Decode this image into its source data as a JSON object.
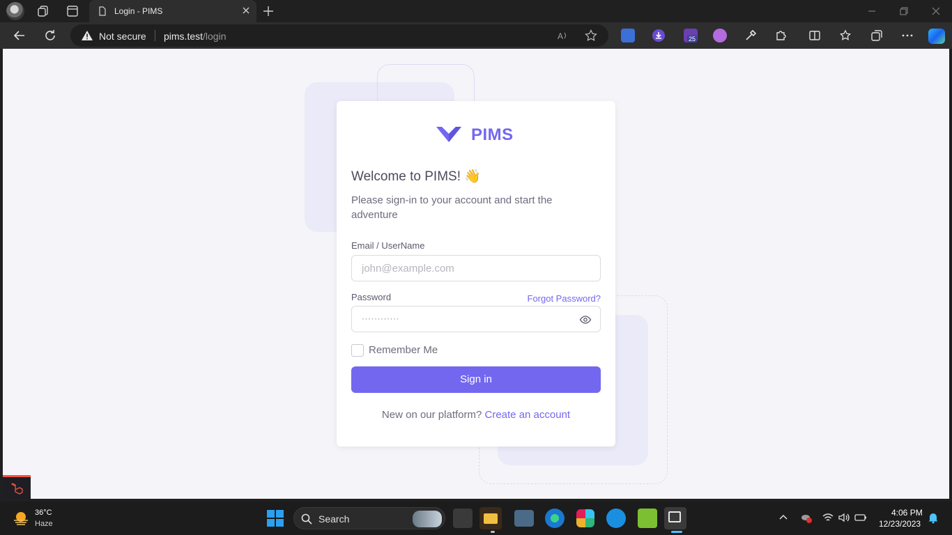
{
  "browser": {
    "tab_title": "Login - PIMS",
    "security_label": "Not secure",
    "url_host": "pims.test",
    "url_path": "/login",
    "extension_badge": "25"
  },
  "login": {
    "brand_name": "PIMS",
    "welcome": "Welcome to PIMS! 👋",
    "subtitle": "Please sign-in to your account and start the adventure",
    "email_label": "Email / UserName",
    "email_placeholder": "john@example.com",
    "password_label": "Password",
    "forgot_label": "Forgot Password?",
    "password_mask": "············",
    "remember_label": "Remember Me",
    "signin_label": "Sign in",
    "signup_prompt": "New on our platform?",
    "signup_link": "Create an account",
    "accent_color": "#7367f0"
  },
  "taskbar": {
    "temperature": "36°C",
    "condition": "Haze",
    "search_label": "Search",
    "time": "4:06 PM",
    "date": "12/23/2023"
  }
}
